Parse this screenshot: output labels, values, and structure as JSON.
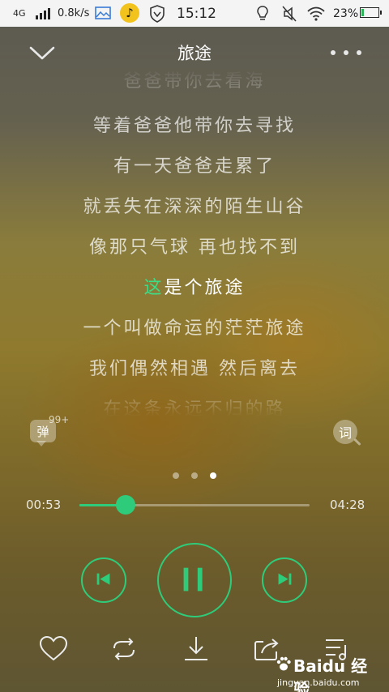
{
  "status_bar": {
    "network": "4G",
    "speed": "0.8k/s",
    "time": "15:12",
    "battery": "23%",
    "battery_level": 0.23,
    "icons": [
      "signal-icon",
      "image-icon",
      "music-app-icon",
      "shield-icon",
      "bulb-icon",
      "mute-icon",
      "wifi-icon",
      "battery-icon"
    ]
  },
  "header": {
    "title": "旅途"
  },
  "lyrics": {
    "lines": [
      "爸爸带你去看海",
      "等着爸爸他带你去寻找",
      "有一天爸爸走累了",
      "就丢失在深深的陌生山谷",
      "像那只气球 再也找不到",
      "这是个旅途",
      "一个叫做命运的茫茫旅途",
      "我们偶然相遇 然后离去",
      "在这条永远不归的路"
    ],
    "current_index": 5,
    "current_line": {
      "sung": "这",
      "unsung": "是个旅途"
    }
  },
  "side_buttons": {
    "danmu_label": "弹",
    "danmu_count": "99+",
    "lyric_label": "词"
  },
  "pager": {
    "count": 3,
    "active": 2
  },
  "playback": {
    "elapsed": "00:53",
    "total": "04:28",
    "progress": 0.2
  },
  "colors": {
    "accent": "#2ecc7a",
    "highlight": "#3ddc86"
  },
  "controls": {
    "icons": [
      "previous-icon",
      "pause-icon",
      "next-icon"
    ]
  },
  "bottom_bar": {
    "icons": [
      "heart-icon",
      "repeat-icon",
      "download-icon",
      "share-icon",
      "playlist-icon"
    ]
  },
  "watermark": {
    "brand": "Baidu 经验",
    "url": "jingyan.baidu.com"
  }
}
